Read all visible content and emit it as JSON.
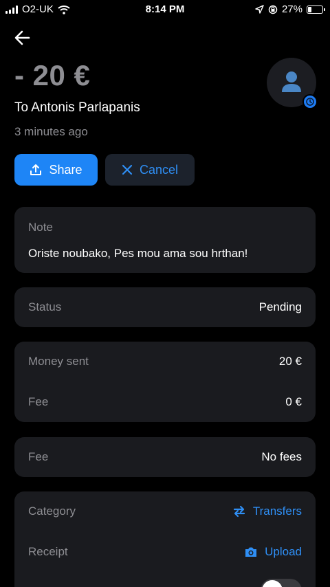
{
  "status_bar": {
    "carrier": "O2-UK",
    "time": "8:14 PM",
    "battery_percent": "27%",
    "battery_level": 0.27,
    "icons": [
      "signal-icon",
      "wifi-icon",
      "location-icon",
      "orientation-lock-icon",
      "battery-icon"
    ]
  },
  "header": {
    "back_icon": "back-arrow-icon",
    "amount": "- 20 €",
    "recipient": "To Antonis Parlapanis",
    "time_ago": "3 minutes ago",
    "avatar_icon": "person-icon",
    "badge_icon": "clock-icon"
  },
  "actions": {
    "share_label": "Share",
    "share_icon": "share-icon",
    "cancel_label": "Cancel",
    "cancel_icon": "close-icon"
  },
  "note": {
    "title": "Note",
    "text": "Oriste noubako, Pes mou ama sou hrthan!"
  },
  "status": {
    "label": "Status",
    "value": "Pending"
  },
  "money": {
    "sent_label": "Money sent",
    "sent_value": "20 €",
    "fee_label": "Fee",
    "fee_value": "0 €"
  },
  "fee_info": {
    "label": "Fee",
    "value": "No fees"
  },
  "details": {
    "category_label": "Category",
    "category_value": "Transfers",
    "category_icon": "transfer-arrows-icon",
    "receipt_label": "Receipt",
    "receipt_value": "Upload",
    "receipt_icon": "camera-icon",
    "toggle_on": false
  },
  "colors": {
    "accent": "#1e85f6",
    "link": "#2f8ff5",
    "card": "#1a1b1f",
    "muted": "#8e8e93",
    "background": "#000000"
  }
}
